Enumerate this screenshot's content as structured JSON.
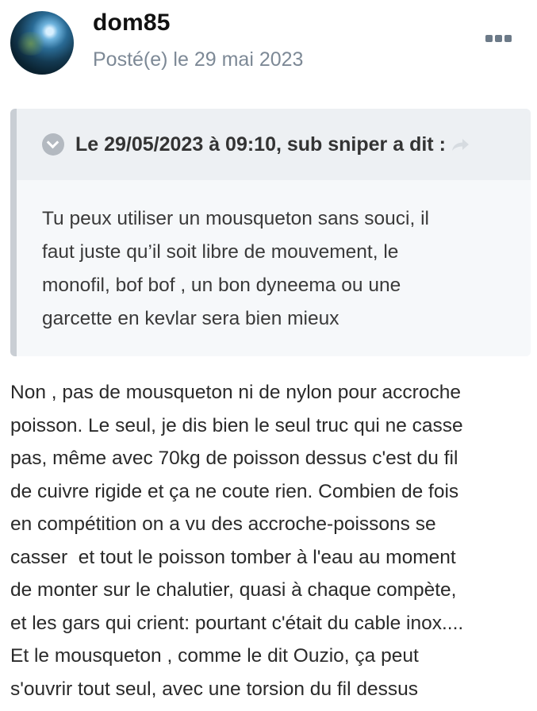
{
  "post": {
    "author": "dom85",
    "date": "Posté(e) le 29 mai 2023",
    "avatar_icon": "user-avatar"
  },
  "quote": {
    "citation": "Le 29/05/2023 à 09:10, sub sniper a dit :",
    "lines": [
      "Tu peux utiliser un mousqueton sans souci, il",
      "faut juste qu’il soit libre de mouvement, le",
      "monofil, bof bof , un bon dyneema ou une",
      "garcette en kevlar sera bien mieux"
    ]
  },
  "content": {
    "lines": [
      "Non , pas de mousqueton ni de nylon pour accroche",
      "poisson. Le seul, je dis bien le seul truc qui ne casse",
      "pas, même avec 70kg de poisson dessus c'est du fil",
      "de cuivre rigide et ça ne coute rien. Combien de fois",
      "en compétition on a vu des accroche-poissons se",
      "casser  et tout le poisson tomber à l'eau au moment",
      "de monter sur le chalutier, quasi à chaque compète,",
      "et les gars qui crient: pourtant c'était du cable inox....",
      "Et le mousqueton , comme le dit Ouzio, ça peut",
      "s'ouvrir tout seul, avec une torsion du fil dessus"
    ]
  },
  "colors": {
    "accent_gray": "#7d8996",
    "quote_bg": "#f6f8fa",
    "quote_header_bg": "#edf0f3",
    "quote_border": "#c9ced4"
  }
}
